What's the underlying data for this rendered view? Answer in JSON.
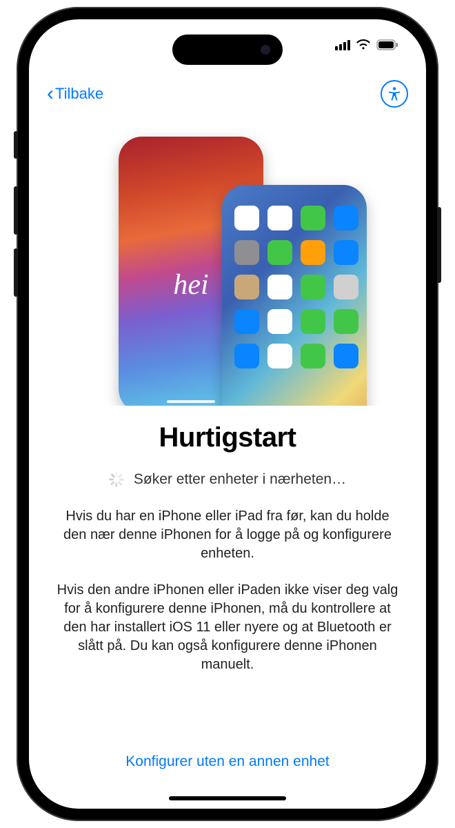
{
  "nav": {
    "back_label": "Tilbake"
  },
  "hero": {
    "greeting": "hei"
  },
  "content": {
    "title": "Hurtigstart",
    "searching": "Søker etter enheter i nærheten…",
    "para1": "Hvis du har en iPhone eller iPad fra før, kan du holde den nær denne iPhonen for å logge på og konfigurere enheten.",
    "para2": "Hvis den andre iPhonen eller iPaden ikke viser deg valg for å konfigurere denne iPhonen, må du kontrollere at den har installert iOS 11 eller nyere og at Bluetooth er slått på. Du kan også konfigurere denne iPhonen manuelt."
  },
  "footer": {
    "manual_setup": "Konfigurer uten en annen enhet"
  },
  "colors": {
    "accent": "#007AFF",
    "app_icons": [
      "#ffffff",
      "#ffffff",
      "#42c648",
      "#0a84ff",
      "#8e8e93",
      "#42c648",
      "#ff9f0a",
      "#0a84ff",
      "#c8a878",
      "#ffffff",
      "#42c648",
      "#d0d0d0",
      "#0a84ff",
      "#ffffff",
      "#42c648",
      "#42c648",
      "#0a84ff",
      "#ffffff",
      "#42c648",
      "#0a84ff"
    ]
  }
}
